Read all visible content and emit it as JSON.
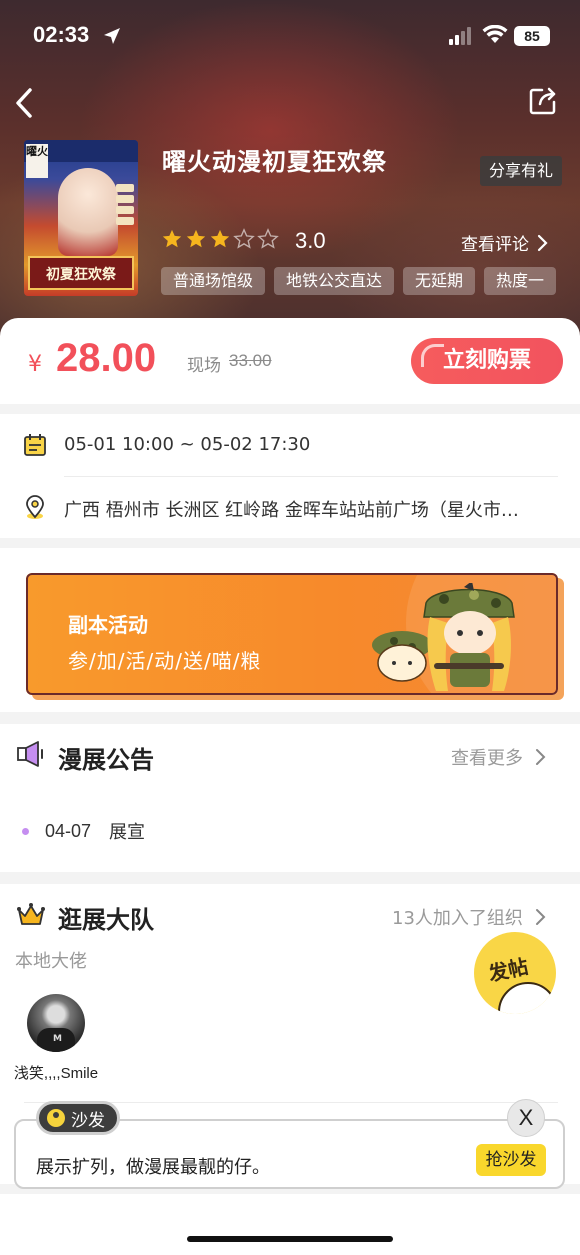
{
  "status_bar": {
    "time": "02:33",
    "battery": "85"
  },
  "header": {
    "share_tip": "分享有礼"
  },
  "event": {
    "poster_logo": "曜火",
    "poster_title": "初夏狂欢祭",
    "title": "曜火动漫初夏狂欢祭",
    "rating": 3.0,
    "rating_text": "3.0",
    "stars_total": 5,
    "view_review": "查看评论",
    "tags": [
      "普通场馆级",
      "地铁公交直达",
      "无延期",
      "热度一"
    ]
  },
  "price": {
    "currency": "¥",
    "amount": "28.00",
    "onsite_label": "现场",
    "onsite_price": "33.00",
    "buy_label": "立刻购票"
  },
  "info": {
    "time_range": "05-01 10:00 ~ 05-02 17:30",
    "address": "广西 梧州市 长洲区 红岭路 金晖车站站前广场（星火市…"
  },
  "activity": {
    "title": "副本活动",
    "subtitle": "参/加/活/动/送/喵/粮"
  },
  "announcement": {
    "title": "漫展公告",
    "more": "查看更多",
    "items": [
      {
        "date": "04-07",
        "text": "展宣"
      }
    ]
  },
  "team": {
    "title": "逛展大队",
    "joined": "13人加入了组织",
    "subtitle": "本地大佬",
    "members": [
      {
        "name": "浅笑,,,,Smile"
      }
    ],
    "post_button": "发帖"
  },
  "sofa": {
    "badge": "沙发",
    "hint": "展示扩列，做漫展最靓的仔。",
    "button": "抢沙发",
    "close": "X"
  },
  "colors": {
    "accent_red": "#f2505a",
    "banner_orange": "#f89a2c",
    "star": "#f6b51e",
    "sofa_yellow": "#f9d72c"
  }
}
